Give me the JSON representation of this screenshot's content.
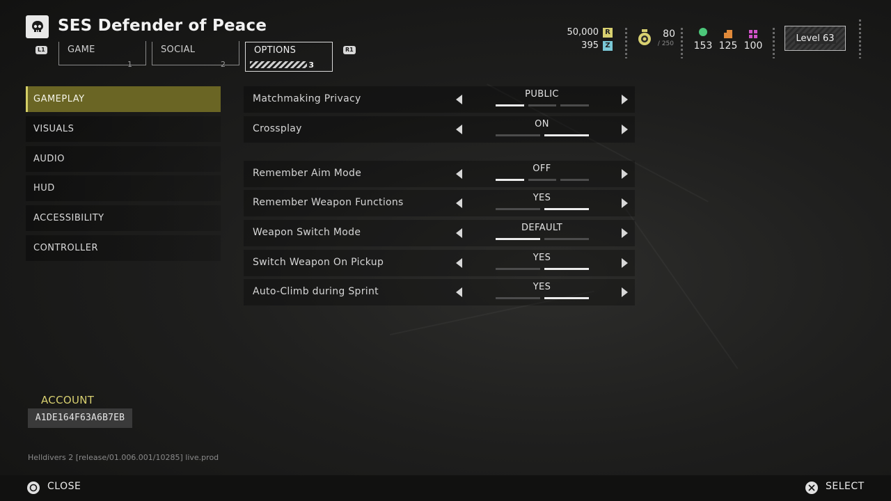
{
  "header": {
    "title": "SES Defender of Peace",
    "ship_icon": "skull-icon",
    "l1_hint": "L1",
    "r1_hint": "R1",
    "tabs": [
      {
        "label": "GAME",
        "num": "1"
      },
      {
        "label": "SOCIAL",
        "num": "2"
      },
      {
        "label": "OPTIONS",
        "num": "3",
        "active": true
      }
    ]
  },
  "currency": {
    "requisition": "50,000",
    "requisition_badge": "R",
    "medals": "395",
    "medals_badge": "Z",
    "super_credits": "80",
    "super_credits_max": "/ 250",
    "samples": [
      {
        "value": "153",
        "icon": "common-sample-icon",
        "color": "#4cc77a"
      },
      {
        "value": "125",
        "icon": "rare-sample-icon",
        "color": "#e08a3a"
      },
      {
        "value": "100",
        "icon": "super-sample-icon",
        "color": "#d052c8"
      }
    ],
    "level": "Level 63"
  },
  "sidebar": {
    "items": [
      {
        "label": "GAMEPLAY",
        "active": true
      },
      {
        "label": "VISUALS"
      },
      {
        "label": "AUDIO"
      },
      {
        "label": "HUD"
      },
      {
        "label": "ACCESSIBILITY"
      },
      {
        "label": "CONTROLLER"
      }
    ]
  },
  "settings": [
    {
      "label": "Matchmaking Privacy",
      "value": "PUBLIC",
      "options": 3,
      "selected": 0
    },
    {
      "label": "Crossplay",
      "value": "ON",
      "options": 2,
      "selected": 1
    },
    {
      "label": "Remember Aim Mode",
      "value": "OFF",
      "options": 3,
      "selected": 0
    },
    {
      "label": "Remember Weapon Functions",
      "value": "YES",
      "options": 2,
      "selected": 1
    },
    {
      "label": "Weapon Switch Mode",
      "value": "DEFAULT",
      "options": 2,
      "selected": 0
    },
    {
      "label": "Switch Weapon On Pickup",
      "value": "YES",
      "options": 2,
      "selected": 1
    },
    {
      "label": "Auto-Climb during Sprint",
      "value": "YES",
      "options": 2,
      "selected": 1
    }
  ],
  "account": {
    "label": "ACCOUNT",
    "id": "A1DE164F63A6B7EB"
  },
  "version": "Helldivers 2 [release/01.006.001/10285] live.prod",
  "footer": {
    "close_label": "CLOSE",
    "close_icon": "circle-button-icon",
    "select_label": "SELECT",
    "select_icon": "cross-button-icon"
  },
  "colors": {
    "accent": "#6a6524",
    "accent_border": "#d4cf66",
    "account_label": "#d8d070"
  }
}
